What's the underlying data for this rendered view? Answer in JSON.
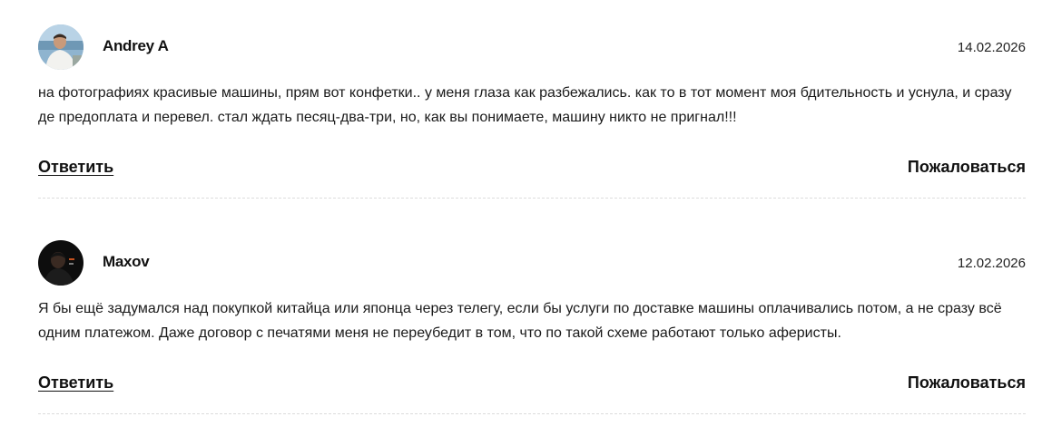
{
  "comments": [
    {
      "author": "Andrey A",
      "date": "14.02.2026",
      "text": "на фотографиях красивые машины, прям вот конфетки.. у меня глаза как разбежались. как то в тот момент моя бдительность и уснула, и сразу де предоплата и перевел. стал ждать песяц-два-три, но, как вы понимаете, машину никто не пригнал!!!",
      "reply_label": "Ответить",
      "report_label": "Пожаловаться",
      "avatar_icon": "user-photo-light"
    },
    {
      "author": "Maxov",
      "date": "12.02.2026",
      "text": "Я бы ещё задумался над покупкой китайца или японца через телегу, если бы услуги по доставке машины оплачивались потом, а не сразу всё одним платежом. Даже договор с печатями меня не переубедит в том, что по такой схеме работают только аферисты.",
      "reply_label": "Ответить",
      "report_label": "Пожаловаться",
      "avatar_icon": "user-photo-dark"
    }
  ]
}
